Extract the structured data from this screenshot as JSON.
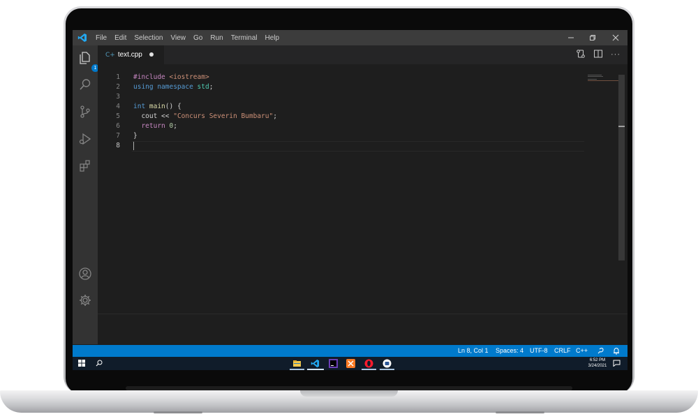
{
  "menu": [
    "File",
    "Edit",
    "Selection",
    "View",
    "Go",
    "Run",
    "Terminal",
    "Help"
  ],
  "window_controls": {
    "minimize": "—",
    "maximize": "❐",
    "close": "✕"
  },
  "activity": {
    "explorer_badge": "1"
  },
  "tab": {
    "icon": "C+",
    "filename": "text.cpp"
  },
  "editor": {
    "line_numbers": [
      "1",
      "2",
      "3",
      "4",
      "5",
      "6",
      "7",
      "8"
    ],
    "lines": [
      [
        {
          "t": "#include ",
          "c": "pp"
        },
        {
          "t": "<iostream>",
          "c": "inc"
        }
      ],
      [
        {
          "t": "using ",
          "c": "kw"
        },
        {
          "t": "namespace ",
          "c": "kw"
        },
        {
          "t": "std",
          "c": "ns"
        },
        {
          "t": ";",
          "c": ""
        }
      ],
      [],
      [
        {
          "t": "int ",
          "c": "kw"
        },
        {
          "t": "main",
          "c": "fn"
        },
        {
          "t": "() {",
          "c": ""
        }
      ],
      [
        {
          "t": "  cout ",
          "c": ""
        },
        {
          "t": "<< ",
          "c": ""
        },
        {
          "t": "\"Concurs Severin Bumbaru\"",
          "c": "str"
        },
        {
          "t": ";",
          "c": ""
        }
      ],
      [
        {
          "t": "  return ",
          "c": "ctl"
        },
        {
          "t": "0",
          "c": "num"
        },
        {
          "t": ";",
          "c": ""
        }
      ],
      [
        {
          "t": "}",
          "c": ""
        }
      ],
      []
    ],
    "active_line": "8"
  },
  "status": {
    "position": "Ln 8, Col 1",
    "spaces": "Spaces: 4",
    "encoding": "UTF-8",
    "eol": "CRLF",
    "language": "C++"
  },
  "taskbar": {
    "time": "6:52 PM",
    "date": "3/24/2021"
  },
  "colors": {
    "accent": "#007acc",
    "titlebar": "#3c3c3c",
    "activity": "#333333",
    "editor": "#1e1e1e"
  }
}
